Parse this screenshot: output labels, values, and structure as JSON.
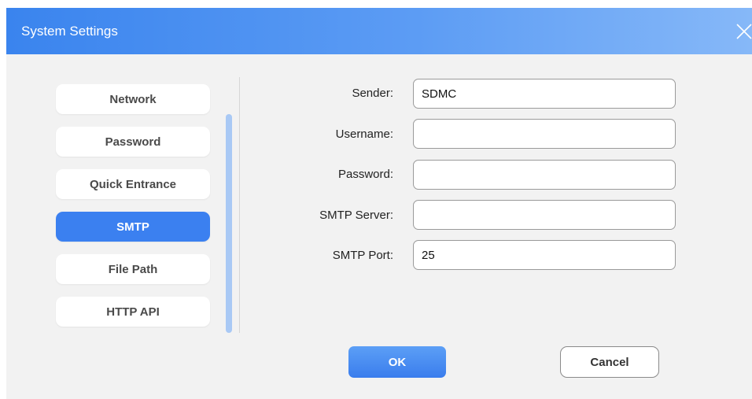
{
  "window": {
    "title": "System Settings",
    "close_icon": "close-icon"
  },
  "sidebar": {
    "items": [
      {
        "label": "Network",
        "active": false
      },
      {
        "label": "Password",
        "active": false
      },
      {
        "label": "Quick Entrance",
        "active": false
      },
      {
        "label": "SMTP",
        "active": true
      },
      {
        "label": "File Path",
        "active": false
      },
      {
        "label": "HTTP API",
        "active": false
      }
    ]
  },
  "form": {
    "sender": {
      "label": "Sender:",
      "value": "SDMC"
    },
    "username": {
      "label": "Username:",
      "value": ""
    },
    "password": {
      "label": "Password:",
      "value": ""
    },
    "smtp_server": {
      "label": "SMTP Server:",
      "value": ""
    },
    "smtp_port": {
      "label": "SMTP Port:",
      "value": "25"
    }
  },
  "actions": {
    "ok_label": "OK",
    "cancel_label": "Cancel"
  },
  "colors": {
    "accent": "#3b80f0",
    "titlebar_start": "#3a84ee",
    "titlebar_end": "#86b8f8",
    "panel_background": "#f2f2f2"
  }
}
